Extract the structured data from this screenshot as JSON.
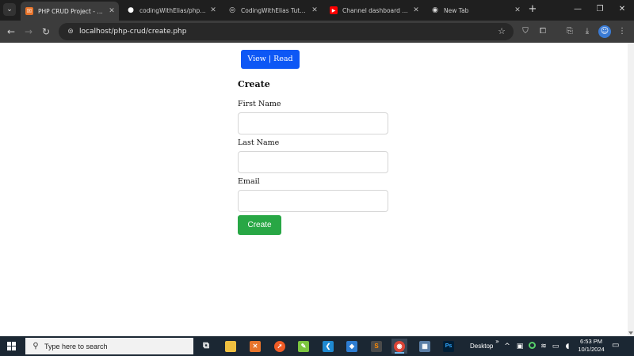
{
  "browser": {
    "tab_menu_icon": "chevron-down-icon",
    "tabs": [
      {
        "title": "PHP CRUD Project - Crea",
        "icon": "xampp-favicon",
        "color": "#e8742b",
        "active": true
      },
      {
        "title": "codingWithElias/php-cru",
        "icon": "github-favicon",
        "color": "#ffffff",
        "active": false
      },
      {
        "title": "CodingWithElias Tutoria",
        "icon": "site-favicon",
        "color": "#cfcfcf",
        "active": false
      },
      {
        "title": "Channel dashboard - You",
        "icon": "youtube-favicon",
        "color": "#ff0000",
        "active": false
      },
      {
        "title": "New Tab",
        "icon": "chrome-favicon",
        "color": "#cfcfcf",
        "active": false
      }
    ],
    "address_bar": {
      "url": "localhost/php-crud/create.php"
    }
  },
  "page": {
    "view_button": "View | Read",
    "title": "Create",
    "fields": [
      {
        "label": "First Name",
        "value": ""
      },
      {
        "label": "Last Name",
        "value": ""
      },
      {
        "label": "Email",
        "value": ""
      }
    ],
    "submit_button": "Create"
  },
  "taskbar": {
    "search_placeholder": "Type here to search",
    "desktop_label": "Desktop",
    "chevron": "»",
    "time": "6:53 PM",
    "date": "10/1/2024",
    "apps": [
      {
        "name": "task-view",
        "glyph": "⧉",
        "color": "#1b2733"
      },
      {
        "name": "file-explorer",
        "glyph": "▬",
        "color": "#f0c040"
      },
      {
        "name": "xampp",
        "glyph": "✕",
        "color": "#e8742b"
      },
      {
        "name": "postman",
        "glyph": "●",
        "color": "#ef5b25"
      },
      {
        "name": "notepad-plus-plus",
        "glyph": "✎",
        "color": "#7cc63f"
      },
      {
        "name": "vscode",
        "glyph": "❮",
        "color": "#1f8ad2"
      },
      {
        "name": "3d-builder",
        "glyph": "◆",
        "color": "#2d7dd2"
      },
      {
        "name": "sublime-text",
        "glyph": "S",
        "color": "#ff8a00"
      },
      {
        "name": "chrome",
        "glyph": "◉",
        "color": "#db4437"
      },
      {
        "name": "slideshow-app",
        "glyph": "▦",
        "color": "#5a7ea6"
      },
      {
        "name": "photoshop",
        "glyph": "Ps",
        "color": "#001e36"
      }
    ]
  },
  "colors": {
    "primary_button": "#0d57f5",
    "success_button": "#28a745"
  }
}
